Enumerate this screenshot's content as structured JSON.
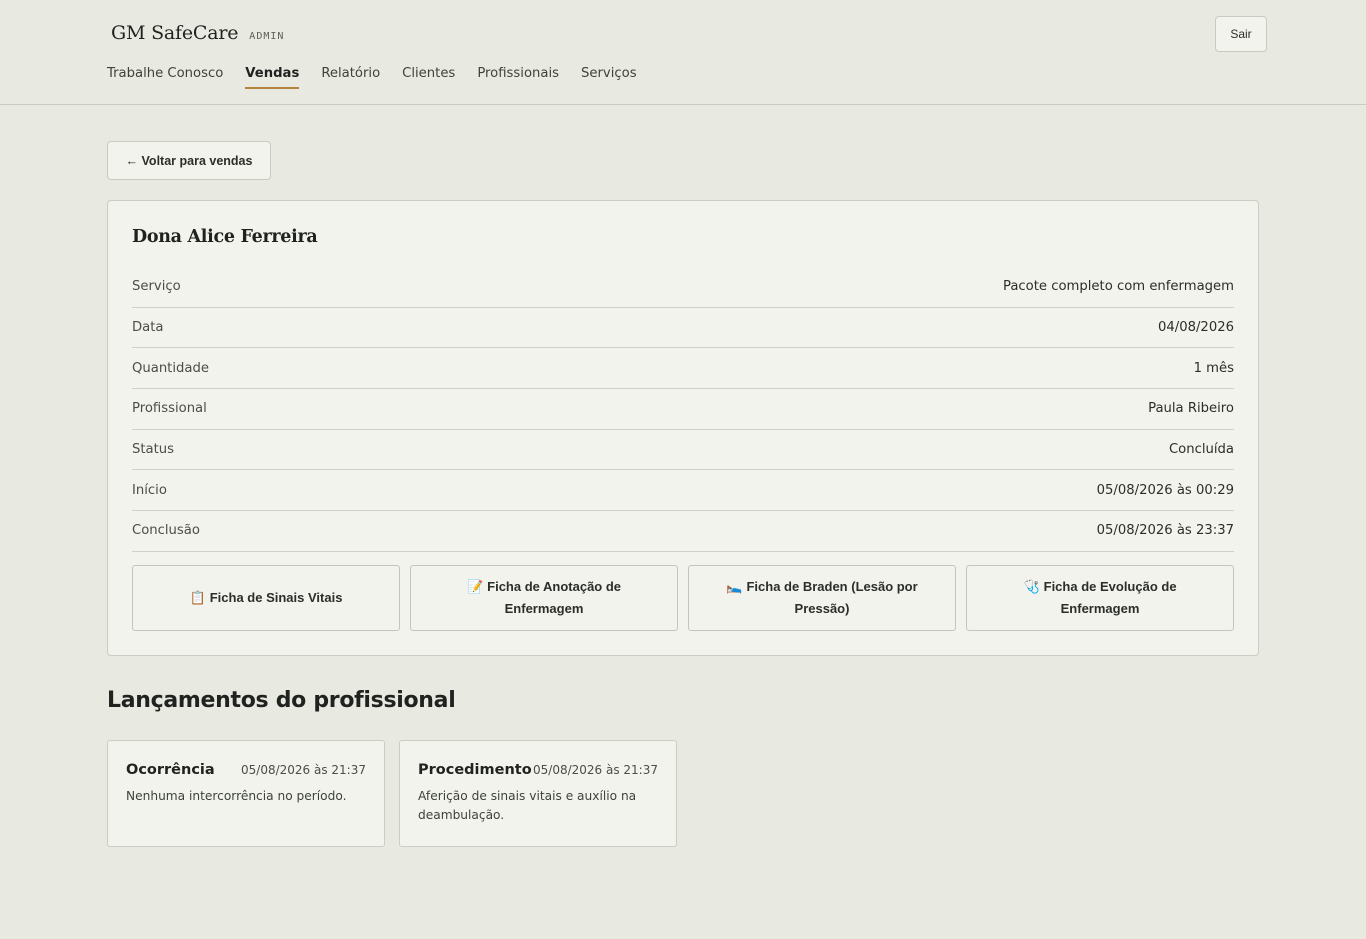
{
  "header": {
    "brand": "GM SafeCare",
    "tag": "ADMIN",
    "logout_label": "Sair",
    "nav": [
      {
        "label": "Trabalhe Conosco",
        "active": false
      },
      {
        "label": "Vendas",
        "active": true
      },
      {
        "label": "Relatório",
        "active": false
      },
      {
        "label": "Clientes",
        "active": false
      },
      {
        "label": "Profissionais",
        "active": false
      },
      {
        "label": "Serviços",
        "active": false
      }
    ]
  },
  "back_label": "← Voltar para vendas",
  "sale": {
    "client_name": "Dona Alice Ferreira",
    "details": [
      {
        "label": "Serviço",
        "value": "Pacote completo com enfermagem"
      },
      {
        "label": "Data",
        "value": "04/08/2026"
      },
      {
        "label": "Quantidade",
        "value": "1 mês"
      },
      {
        "label": "Profissional",
        "value": "Paula Ribeiro"
      },
      {
        "label": "Status",
        "value": "Concluída"
      },
      {
        "label": "Início",
        "value": "05/08/2026 às 00:29"
      },
      {
        "label": "Conclusão",
        "value": "05/08/2026 às 23:37"
      }
    ],
    "forms": [
      {
        "icon": "📋",
        "icon_name": "clipboard-icon",
        "label": "Ficha de Sinais Vitais"
      },
      {
        "icon": "📝",
        "icon_name": "memo-icon",
        "label": "Ficha de Anotação de Enfermagem"
      },
      {
        "icon": "🛌",
        "icon_name": "bed-icon",
        "label": "Ficha de Braden (Lesão por Pressão)"
      },
      {
        "icon": "🩺",
        "icon_name": "stethoscope-icon",
        "label": "Ficha de Evolução de Enfermagem"
      }
    ]
  },
  "entries_section": {
    "title": "Lançamentos do profissional",
    "entries": [
      {
        "type": "Ocorrência",
        "time": "05/08/2026 às 21:37",
        "text": "Nenhuma intercorrência no período."
      },
      {
        "type": "Procedimento",
        "time": "05/08/2026 às 21:37",
        "text": "Aferição de sinais vitais e auxílio na deambulação."
      }
    ]
  }
}
